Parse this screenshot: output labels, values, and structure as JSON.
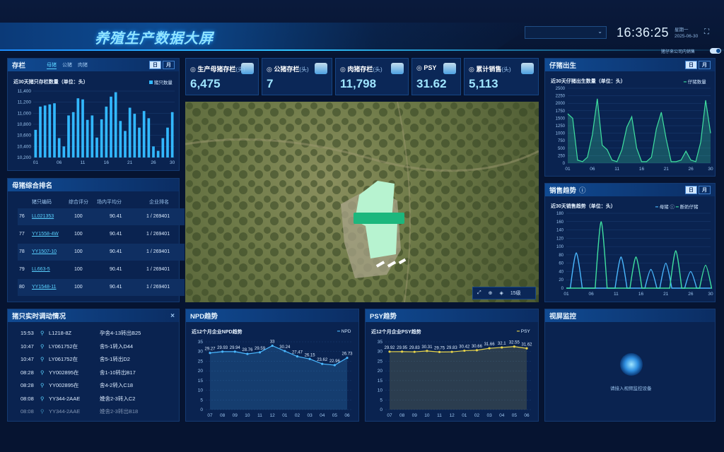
{
  "header": {
    "title": "养殖生产数据大屏",
    "select_value": "",
    "clock": "16:36:25",
    "weekday": "星期一",
    "date": "2025-06-30",
    "toggle_label": "猪仔来公司内销售"
  },
  "colors": {
    "accent": "#2fc4ff",
    "bar": "#32b8ff",
    "green": "#3fe0a0",
    "line_blue": "#4ab8ff",
    "yellow": "#e8d44a"
  },
  "stock": {
    "title": "存栏",
    "tabs": [
      "母猪",
      "公猪",
      "肉猪"
    ],
    "period": [
      "日",
      "月"
    ],
    "subtitle": "近30天猪只存栏数量（单位：头）",
    "legend": "猪只数量",
    "chart_data": {
      "type": "bar",
      "x_ticks": [
        "01",
        "06",
        "11",
        "16",
        "21",
        "26",
        "30"
      ],
      "y_ticks": [
        "10,200",
        "10,400",
        "10,600",
        "10,800",
        "11,000",
        "11,200",
        "11,400"
      ],
      "ylim": [
        10200,
        11400
      ],
      "values": [
        10700,
        11120,
        11140,
        11160,
        11180,
        10550,
        10400,
        10960,
        11020,
        11270,
        11250,
        10880,
        10960,
        10560,
        10890,
        11120,
        11300,
        11380,
        10860,
        10680,
        11100,
        10990,
        10740,
        11040,
        10910,
        10400,
        10320,
        10550,
        10740,
        11020
      ]
    }
  },
  "kpis": [
    {
      "label": "生产母猪存栏",
      "unit": "(头)",
      "value": "6,475",
      "icon": "sow-icon"
    },
    {
      "label": "公猪存栏",
      "unit": "(头)",
      "value": "7",
      "icon": "boar-icon"
    },
    {
      "label": "肉猪存栏",
      "unit": "(头)",
      "value": "11,798",
      "icon": "pig-icon"
    },
    {
      "label": "PSY",
      "unit": "",
      "value": "31.62",
      "icon": "psy-icon"
    },
    {
      "label": "累计销售",
      "unit": "(头)",
      "value": "5,113",
      "icon": "sales-icon"
    }
  ],
  "ranking": {
    "title": "母猪综合排名",
    "headers": [
      "猪只编码",
      "综合评分",
      "场内平均分",
      "企业排名"
    ],
    "rows": [
      {
        "rank": "76",
        "code": "LL021353",
        "score": "100",
        "avg": "90.41",
        "ent": "1 / 269401"
      },
      {
        "rank": "77",
        "code": "YY1558-4W",
        "score": "100",
        "avg": "90.41",
        "ent": "1 / 269401"
      },
      {
        "rank": "78",
        "code": "YY1507-10",
        "score": "100",
        "avg": "90.41",
        "ent": "1 / 269401"
      },
      {
        "rank": "79",
        "code": "LL663-5",
        "score": "100",
        "avg": "90.41",
        "ent": "1 / 269401"
      },
      {
        "rank": "80",
        "code": "YY1548-11",
        "score": "100",
        "avg": "90.41",
        "ent": "1 / 269401"
      }
    ]
  },
  "events": {
    "title": "猪只实时调动情况",
    "close": "×",
    "items": [
      {
        "time": "15:53",
        "id": "L1218-8Z",
        "desc": "孕舍4-13转出B25"
      },
      {
        "time": "10:47",
        "id": "LY061752在",
        "desc": "舍5-1转入D44"
      },
      {
        "time": "10:47",
        "id": "LY061752在",
        "desc": "舍5-1转出D2"
      },
      {
        "time": "08:28",
        "id": "YY002895在",
        "desc": "舍1-10转出B17"
      },
      {
        "time": "08:28",
        "id": "YY002895在",
        "desc": "舍4-2转入C18"
      },
      {
        "time": "08:08",
        "id": "YY344-2AAE",
        "desc": "娩舍2-3转入C2"
      },
      {
        "time": "08:08",
        "id": "YY344-2AAE",
        "desc": "娩舍2-3转出B18"
      }
    ]
  },
  "map": {
    "zoom": "15级",
    "marker_text": ""
  },
  "npd": {
    "title": "NPD趋势",
    "subtitle": "近12个月企业NPD趋势",
    "legend": "NPD",
    "chart_data": {
      "type": "line",
      "x": [
        "07",
        "08",
        "09",
        "10",
        "11",
        "12",
        "01",
        "02",
        "03",
        "04",
        "05",
        "06"
      ],
      "values": [
        29.27,
        29.93,
        29.94,
        28.76,
        29.59,
        33,
        30.24,
        27.47,
        26.15,
        23.62,
        22.96,
        26.73
      ],
      "labels": [
        "29.27",
        "29.93",
        "29.94",
        "28.76",
        "29.59",
        "33",
        "30.24",
        "27.47",
        "26.15",
        "23.62",
        "22.96",
        "26.73"
      ],
      "ylim": [
        0,
        35
      ],
      "y_ticks": [
        "0",
        "5",
        "10",
        "15",
        "20",
        "25",
        "30",
        "35"
      ]
    }
  },
  "psy": {
    "title": "PSY趋势",
    "subtitle": "近12个月企业PSY趋势",
    "legend": "PSY",
    "chart_data": {
      "type": "line",
      "x": [
        "07",
        "08",
        "09",
        "10",
        "11",
        "12",
        "01",
        "02",
        "03",
        "04",
        "05",
        "06"
      ],
      "values": [
        29.92,
        29.95,
        29.83,
        30.31,
        29.75,
        29.83,
        30.42,
        30.66,
        31.66,
        32.1,
        32.55,
        31.62
      ],
      "labels": [
        "29.92",
        "29.95",
        "29.83",
        "30.31",
        "29.75",
        "29.83",
        "30.42",
        "30.66",
        "31.66",
        "32.1",
        "32.55",
        "31.62"
      ],
      "ylim": [
        0,
        35
      ],
      "y_ticks": [
        "0",
        "5",
        "10",
        "15",
        "20",
        "25",
        "30",
        "35"
      ]
    }
  },
  "births": {
    "title": "仔猪出生",
    "period": [
      "日",
      "月"
    ],
    "subtitle": "近30天仔猪出生数量（单位：头）",
    "legend": "仔猪数量",
    "chart_data": {
      "type": "area",
      "x_ticks": [
        "01",
        "06",
        "11",
        "16",
        "21",
        "26",
        "30"
      ],
      "y_ticks": [
        "0",
        "250",
        "500",
        "750",
        "1000",
        "1250",
        "1500",
        "1750",
        "2000",
        "2250",
        "2500"
      ],
      "ylim": [
        0,
        2500
      ],
      "values": [
        1650,
        1500,
        100,
        50,
        200,
        950,
        2150,
        600,
        450,
        100,
        50,
        450,
        1200,
        1550,
        500,
        50,
        50,
        200,
        1150,
        1700,
        800,
        50,
        50,
        100,
        400,
        100,
        50,
        700,
        2100,
        1000
      ]
    }
  },
  "sales": {
    "title": "销售趋势",
    "period": [
      "日",
      "月"
    ],
    "subtitle": "近30天销售趋势（单位：头）",
    "legend_a": "母猪",
    "legend_b": "断奶仔猪",
    "chart_data": {
      "type": "line",
      "x_ticks": [
        "01",
        "06",
        "11",
        "16",
        "21",
        "26",
        "30"
      ],
      "y_ticks": [
        "0",
        "20",
        "40",
        "60",
        "80",
        "100",
        "120",
        "140",
        "160",
        "180"
      ],
      "ylim": [
        0,
        180
      ],
      "series": [
        {
          "name": "母猪",
          "peaks": [
            [
              2,
              85
            ],
            [
              11,
              75
            ],
            [
              17,
              45
            ],
            [
              20,
              60
            ],
            [
              25,
              40
            ]
          ]
        },
        {
          "name": "断奶仔猪",
          "peaks": [
            [
              7,
              160
            ],
            [
              14,
              75
            ],
            [
              22,
              90
            ],
            [
              28,
              55
            ]
          ]
        }
      ]
    }
  },
  "video": {
    "title": "视屏监控",
    "message": "请接入视频监控设备"
  }
}
